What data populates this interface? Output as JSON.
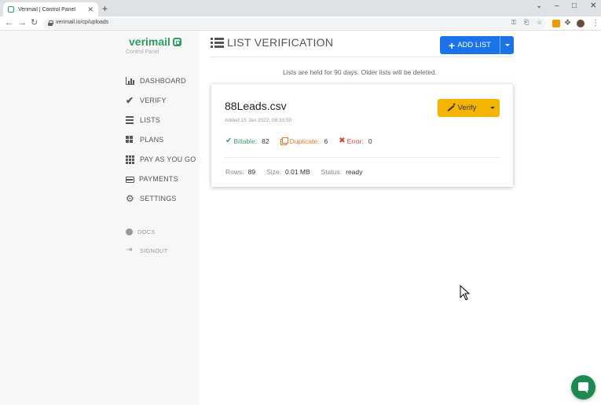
{
  "browser": {
    "tab_title": "Verimail | Control Panel",
    "url": "verimail.io/cp/uploads"
  },
  "sidebar": {
    "brand": "verimail",
    "brand_subtitle": "Control Panel",
    "items": [
      {
        "label": "DASHBOARD",
        "icon": "bar-chart-icon"
      },
      {
        "label": "VERIFY",
        "icon": "check-icon"
      },
      {
        "label": "LISTS",
        "icon": "list-icon"
      },
      {
        "label": "PLANS",
        "icon": "grid-icon"
      },
      {
        "label": "PAY AS YOU GO",
        "icon": "grid-nine-icon"
      },
      {
        "label": "PAYMENTS",
        "icon": "credit-card-icon"
      },
      {
        "label": "SETTINGS",
        "icon": "gear-icon"
      }
    ],
    "secondary": [
      {
        "label": "DOCS",
        "icon": "info-icon"
      },
      {
        "label": "SIGNOUT",
        "icon": "sign-out-icon"
      }
    ]
  },
  "main": {
    "page_title": "LIST VERIFICATION",
    "add_list_label": "ADD LIST",
    "notice": "Lists are held for 90 days. Older lists will be deleted.",
    "list": {
      "file_name": "88Leads.csv",
      "added": "Added 15 Jan 2022, 08:33:50",
      "verify_label": "Verify",
      "billable_label": "Billable:",
      "billable_value": "82",
      "duplicate_label": "Duplicate:",
      "duplicate_value": "6",
      "error_label": "Error:",
      "error_value": "0",
      "rows_label": "Rows:",
      "rows_value": "89",
      "size_label": "Size:",
      "size_value": "0.01 MB",
      "status_label": "Status:",
      "status_value": "ready"
    }
  },
  "colors": {
    "brand_green": "#2e9c5e",
    "primary_blue": "#1a73e8",
    "verify_yellow": "#f4b400",
    "billable_green": "#3aa46a",
    "duplicate_orange": "#e5792f",
    "error_red": "#d9453a"
  }
}
